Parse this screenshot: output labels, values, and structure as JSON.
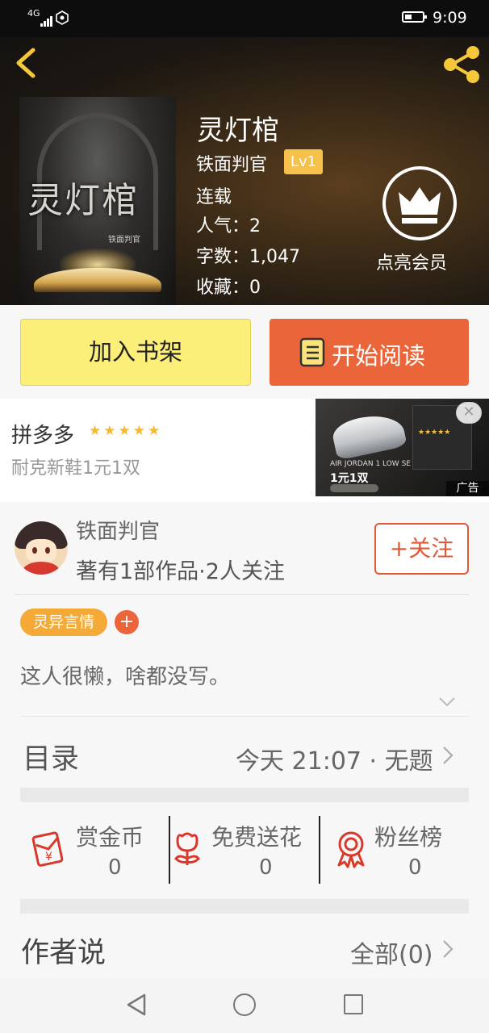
{
  "status_bar": {
    "network": "4G",
    "time": "9:09",
    "battery_level": 0.3
  },
  "book": {
    "title": "灵灯棺",
    "author": "铁面判官",
    "author_level": "Lv1",
    "status": "连载",
    "popularity": "人气：2",
    "word_count": "字数：1,047",
    "favorites": "收藏：0",
    "cover_title": "灵灯棺",
    "cover_author": "铁面判官"
  },
  "vip": {
    "label": "点亮会员"
  },
  "actions": {
    "add_to_shelf": "加入书架",
    "start_reading": "开始阅读"
  },
  "ad": {
    "advertiser": "拼多多",
    "stars": "★★★★★",
    "description": "耐克新鞋1元1双",
    "image_line1": "AIR JORDAN 1 LOW SE",
    "image_line2": "1元1双",
    "image_card_stars": "★★★★★",
    "tag": "广告",
    "close_symbol": "✕"
  },
  "author_card": {
    "name": "铁面判官",
    "description": "著有1部作品·2人关注",
    "follow_label": "+关注",
    "tag": "灵异言情",
    "tag_add": "+",
    "bio": "这人很懒，啥都没写。"
  },
  "toc": {
    "label": "目录",
    "latest": "今天 21:07 · 无题"
  },
  "rewards": [
    {
      "name": "赏金币",
      "count": "0"
    },
    {
      "name": "免费送花",
      "count": "0"
    },
    {
      "name": "粉丝榜",
      "count": "0"
    }
  ],
  "author_says": {
    "label": "作者说",
    "all": "全部(0)"
  },
  "colors": {
    "accent_orange": "#ea6539",
    "shelf_yellow": "#fbef7a",
    "level_gold": "#f5c14a",
    "tag_orange": "#f5a936",
    "icon_red": "#d9392b"
  }
}
